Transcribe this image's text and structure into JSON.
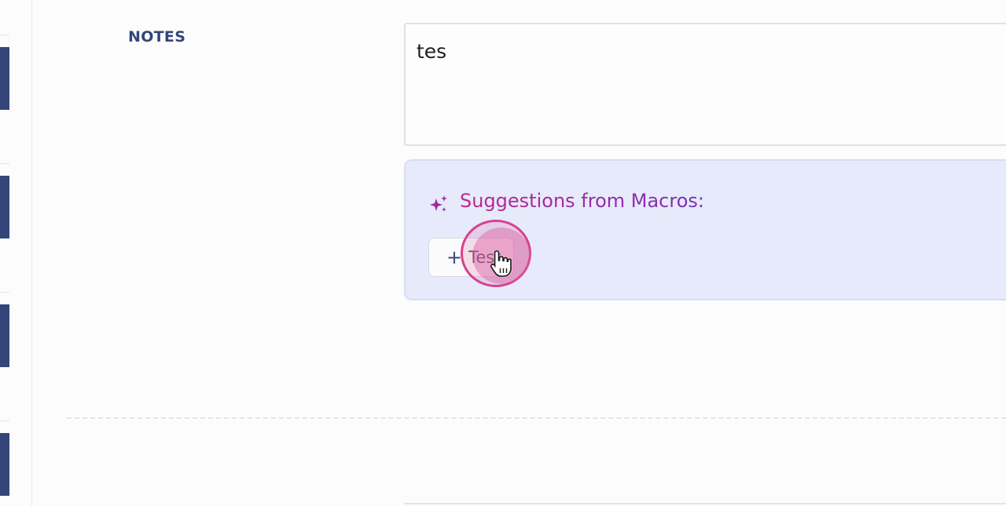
{
  "notes": {
    "label": "NOTES",
    "value": "tes"
  },
  "suggestions": {
    "title": "Suggestions from Macros:",
    "icon": "sparkle-icon",
    "chips": [
      {
        "label": "Test",
        "icon": "plus-icon"
      }
    ]
  },
  "colors": {
    "sidebar_tab": "#34457a",
    "label": "#34457a",
    "suggestions_bg": "#e6eafa",
    "suggestions_title_gradient": [
      "#c0268e",
      "#7b2fb8"
    ],
    "click_highlight": "#d9408e"
  }
}
